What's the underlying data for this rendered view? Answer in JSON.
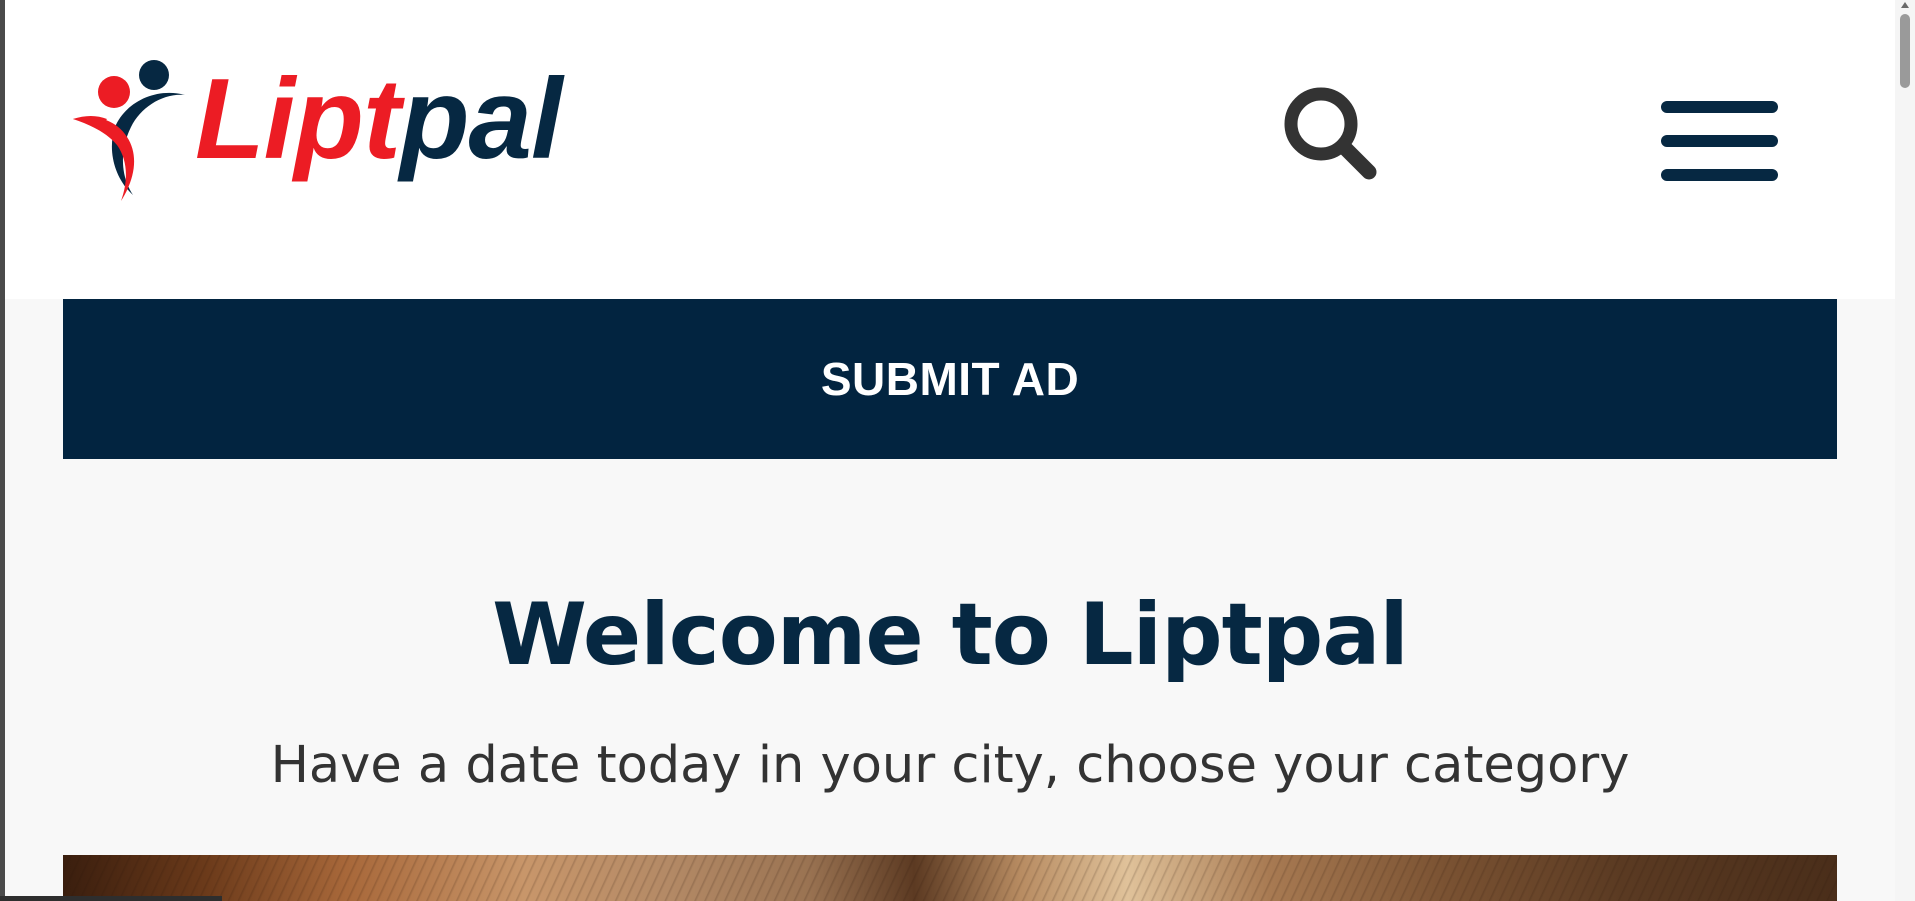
{
  "brand": {
    "name_part_red": "Lipt",
    "name_part_navy": "pal",
    "colors": {
      "red": "#ec1c24",
      "navy": "#062842"
    }
  },
  "header": {
    "search_icon": "search-icon",
    "menu_icon": "hamburger-menu-icon"
  },
  "cta": {
    "submit_label": "SUBMIT AD",
    "color": "#022440"
  },
  "main": {
    "title": "Welcome to Liptpal",
    "subtitle": "Have a date today in your city, choose your category"
  }
}
